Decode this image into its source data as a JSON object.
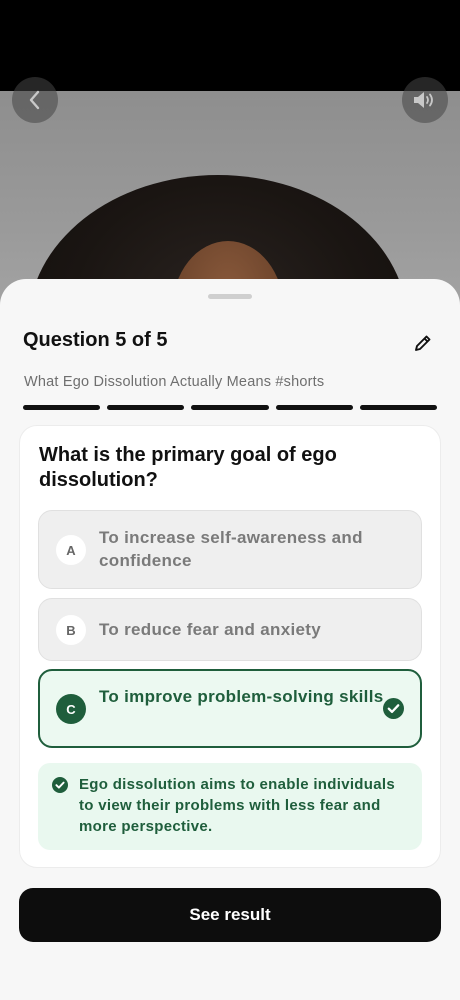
{
  "video": {
    "back_icon": "chevron-left-icon",
    "sound_icon": "speaker-icon"
  },
  "quiz": {
    "header": "Question 5 of 5",
    "edit_icon": "pencil-icon",
    "video_title": "What Ego Dissolution Actually Means #shorts",
    "total_questions": 5,
    "completed_questions": 5,
    "question": "What is the primary goal of ego dissolution?",
    "options": [
      {
        "letter": "A",
        "text": "To increase self-awareness and confidence",
        "selected": false
      },
      {
        "letter": "B",
        "text": "To reduce fear and anxiety",
        "selected": false
      },
      {
        "letter": "C",
        "text": "To improve problem-solving skills",
        "selected": true,
        "correct": true
      }
    ],
    "explanation": "Ego dissolution aims to enable individuals to view their problems with less fear and more perspective.",
    "result_button": "See result"
  },
  "colors": {
    "correct_green": "#1f5e3c",
    "correct_bg": "#ecf9f1",
    "button_bg": "#0d0d0d"
  }
}
